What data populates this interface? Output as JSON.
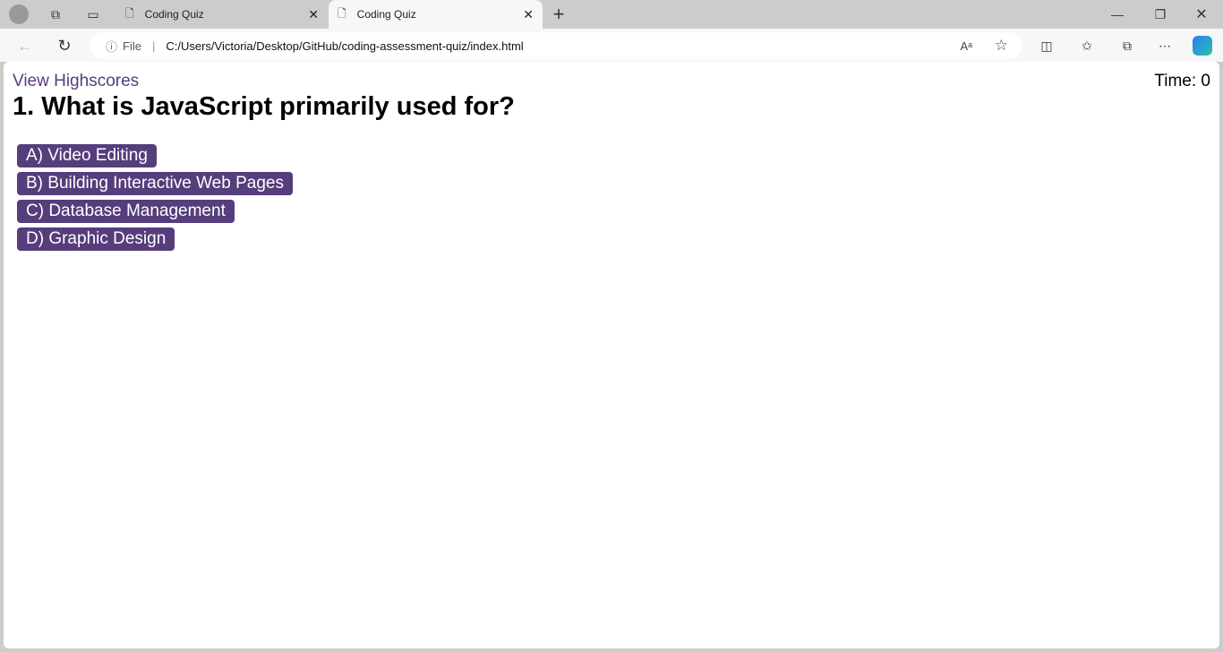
{
  "browser": {
    "tabs": [
      {
        "title": "Coding Quiz",
        "active": false
      },
      {
        "title": "Coding Quiz",
        "active": true
      }
    ],
    "address": {
      "scheme_label": "File",
      "url": "C:/Users/Victoria/Desktop/GitHub/coding-assessment-quiz/index.html"
    }
  },
  "page": {
    "highscores_link": "View Highscores",
    "timer": "Time: 0",
    "question": "1. What is JavaScript primarily used for?",
    "answers": [
      "A) Video Editing",
      "B) Building Interactive Web Pages",
      "C) Database Management",
      "D) Graphic Design"
    ]
  },
  "colors": {
    "accent": "#563d7c"
  }
}
